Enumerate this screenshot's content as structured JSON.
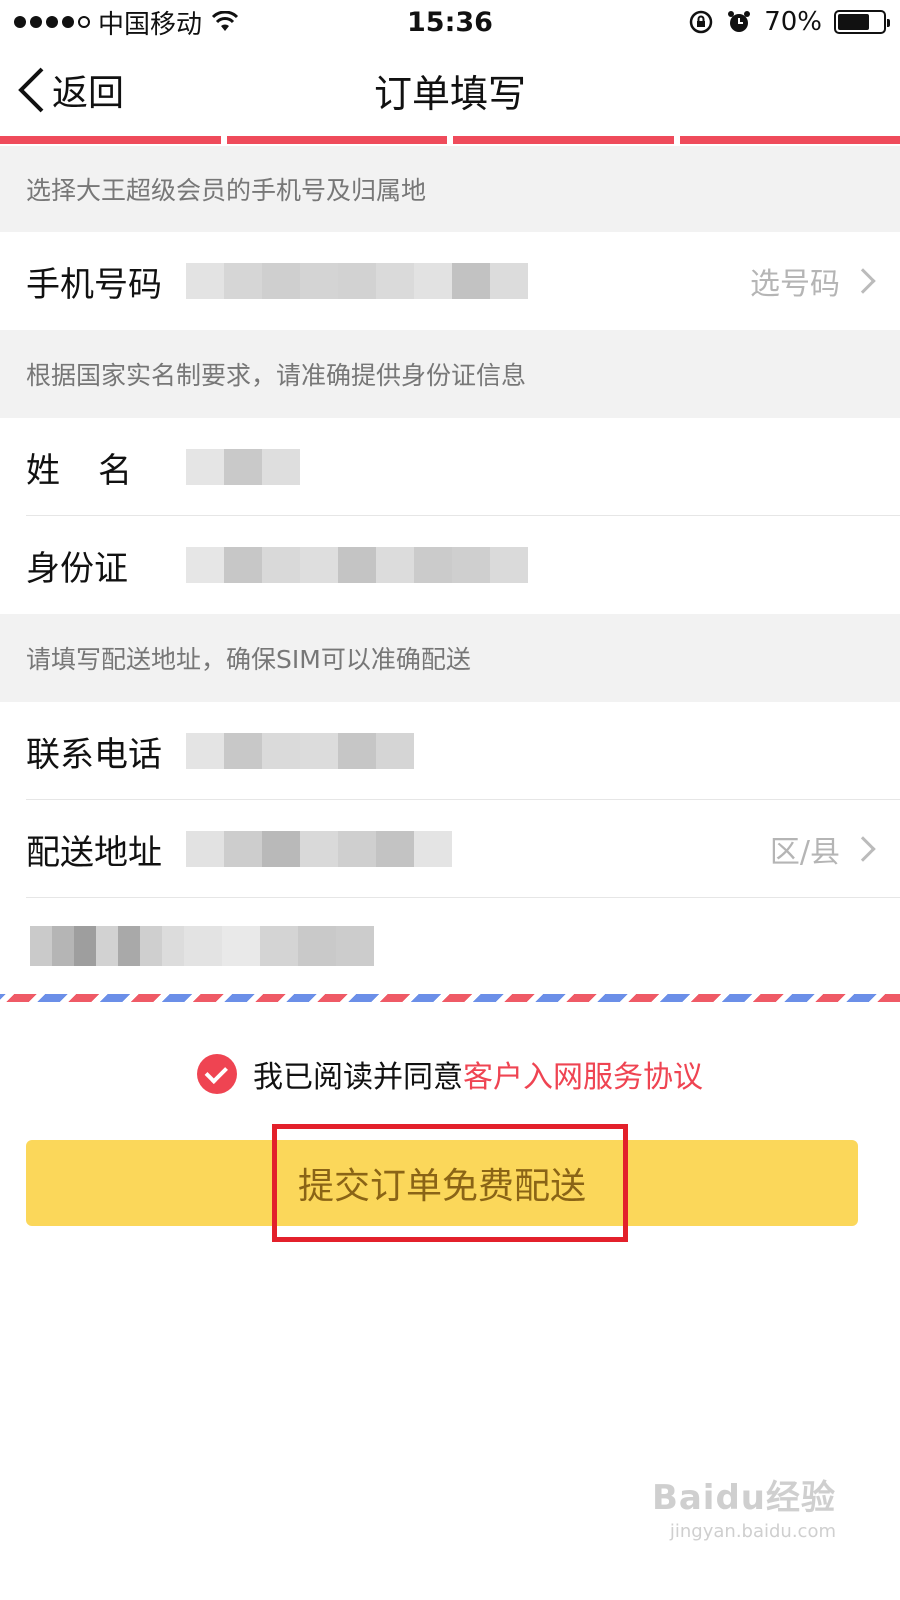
{
  "status_bar": {
    "carrier": "中国移动",
    "time": "15:36",
    "battery_percent": "70%",
    "battery_level": 0.7
  },
  "nav": {
    "back_label": "返回",
    "title": "订单填写"
  },
  "sections": {
    "phone_hint": "选择大王超级会员的手机号及归属地",
    "id_hint": "根据国家实名制要求，请准确提供身份证信息",
    "address_hint": "请填写配送地址，确保SIM可以准确配送"
  },
  "fields": {
    "phone_label": "手机号码",
    "phone_action": "选号码",
    "name_label": "姓名",
    "id_label": "身份证",
    "contact_label": "联系电话",
    "address_label": "配送地址",
    "address_action": "区/县"
  },
  "agreement": {
    "text": "我已阅读并同意",
    "link": "客户入网服务协议"
  },
  "submit_label": "提交订单免费配送",
  "watermark": {
    "main": "Baidu经验",
    "sub": "jingyan.baidu.com"
  }
}
